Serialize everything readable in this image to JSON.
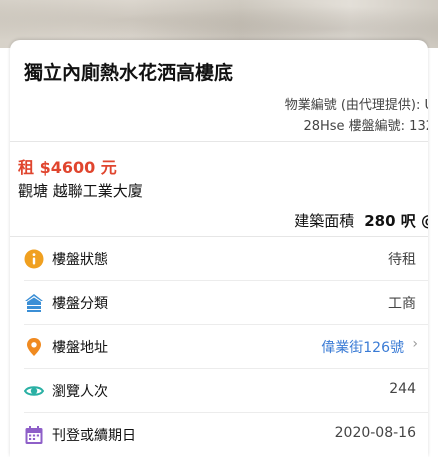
{
  "listing": {
    "title": "獨立內廁熱水花洒高樓底",
    "agent_ref": "物業編號 (由代理提供): U",
    "site_ref": "28Hse 樓盤編號: 132",
    "price": "租  $4600 元",
    "location": "觀塘 越聯工業大廈",
    "area_label": "建築面積",
    "area_value": "280 呎 @"
  },
  "details": [
    {
      "label": "樓盤狀態",
      "value": "待租",
      "icon": "info-icon"
    },
    {
      "label": "樓盤分類",
      "value": "工商",
      "icon": "building-icon"
    },
    {
      "label": "樓盤地址",
      "value": "偉業街126號",
      "icon": "map-pin-icon"
    },
    {
      "label": "瀏覽人次",
      "value": "244",
      "icon": "eye-icon"
    },
    {
      "label": "刊登或續期日",
      "value": "2020-08-16",
      "icon": "calendar-icon"
    }
  ],
  "colors": {
    "price": "#e0452e",
    "link": "#3a7bd5",
    "info_icon": "#f0a020",
    "building_icon": "#3b8fd6",
    "pin_icon": "#f08a20",
    "eye_icon": "#2ab0a4",
    "calendar_icon": "#8e5fc8"
  }
}
